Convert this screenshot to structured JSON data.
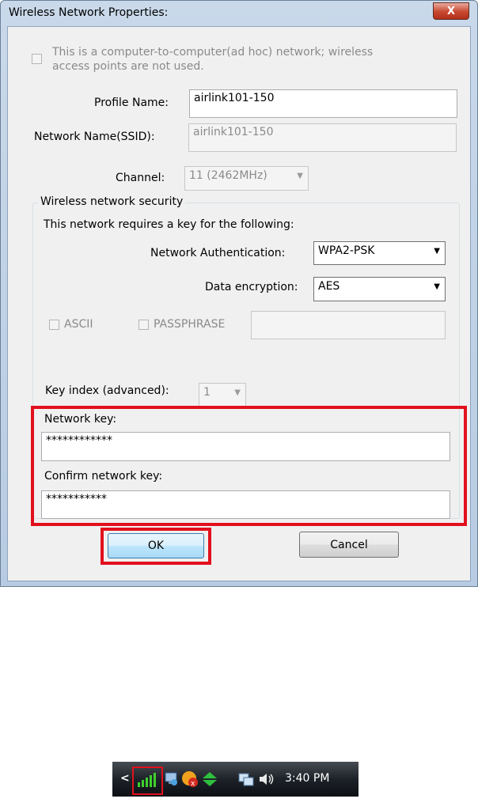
{
  "window": {
    "title": "Wireless Network Properties:",
    "close_glyph": "X"
  },
  "adhoc": {
    "checked": false,
    "label_line1": "This is a computer-to-computer(ad hoc) network; wireless",
    "label_line2": "access points are not used."
  },
  "profile": {
    "label": "Profile Name:",
    "value": "airlink101-150"
  },
  "ssid": {
    "label": "Network Name(SSID):",
    "value": "airlink101-150"
  },
  "channel": {
    "label": "Channel:",
    "value": "11 (2462MHz)"
  },
  "security": {
    "group_title": "Wireless network security",
    "requires_text": "This network requires a key for the following:",
    "auth_label": "Network Authentication:",
    "auth_value": "WPA2-PSK",
    "enc_label": "Data encryption:",
    "enc_value": "AES",
    "ascii_label": "ASCII",
    "passphrase_label": "PASSPHRASE",
    "passphrase_value": "",
    "key_index_label": "Key index (advanced):",
    "key_index_value": "1",
    "network_key_label": "Network key:",
    "network_key_value": "************",
    "confirm_key_label": "Confirm network key:",
    "confirm_key_value": "***********"
  },
  "buttons": {
    "ok": "OK",
    "cancel": "Cancel"
  },
  "taskbar": {
    "chevron": "<",
    "clock": "3:40 PM",
    "icons": [
      "signal-strength-icon",
      "network-monitor-icon",
      "security-alert-icon",
      "sync-arrows-icon",
      "network-connection-icon",
      "volume-icon"
    ]
  },
  "colors": {
    "highlight_red": "#e2101d",
    "signal_green": "#3fcf2c"
  }
}
